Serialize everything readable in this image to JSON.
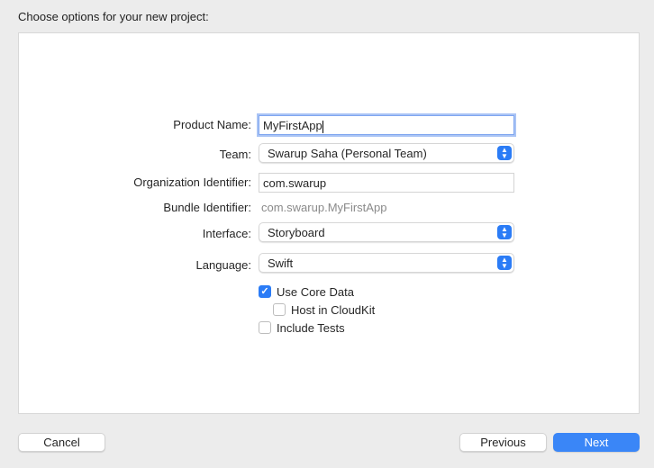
{
  "dialog": {
    "title": "Choose options for your new project:"
  },
  "form": {
    "product_name": {
      "label": "Product Name:",
      "value": "MyFirstApp"
    },
    "team": {
      "label": "Team:",
      "value": "Swarup Saha (Personal Team)"
    },
    "org_id": {
      "label": "Organization Identifier:",
      "value": "com.swarup"
    },
    "bundle_id": {
      "label": "Bundle Identifier:",
      "value": "com.swarup.MyFirstApp"
    },
    "interface": {
      "label": "Interface:",
      "value": "Storyboard"
    },
    "language": {
      "label": "Language:",
      "value": "Swift"
    },
    "use_core_data": {
      "label": "Use Core Data",
      "checked": true
    },
    "host_cloudkit": {
      "label": "Host in CloudKit",
      "checked": false
    },
    "include_tests": {
      "label": "Include Tests",
      "checked": false
    }
  },
  "buttons": {
    "cancel": "Cancel",
    "previous": "Previous",
    "next": "Next"
  },
  "colors": {
    "accent": "#3a86f7"
  }
}
